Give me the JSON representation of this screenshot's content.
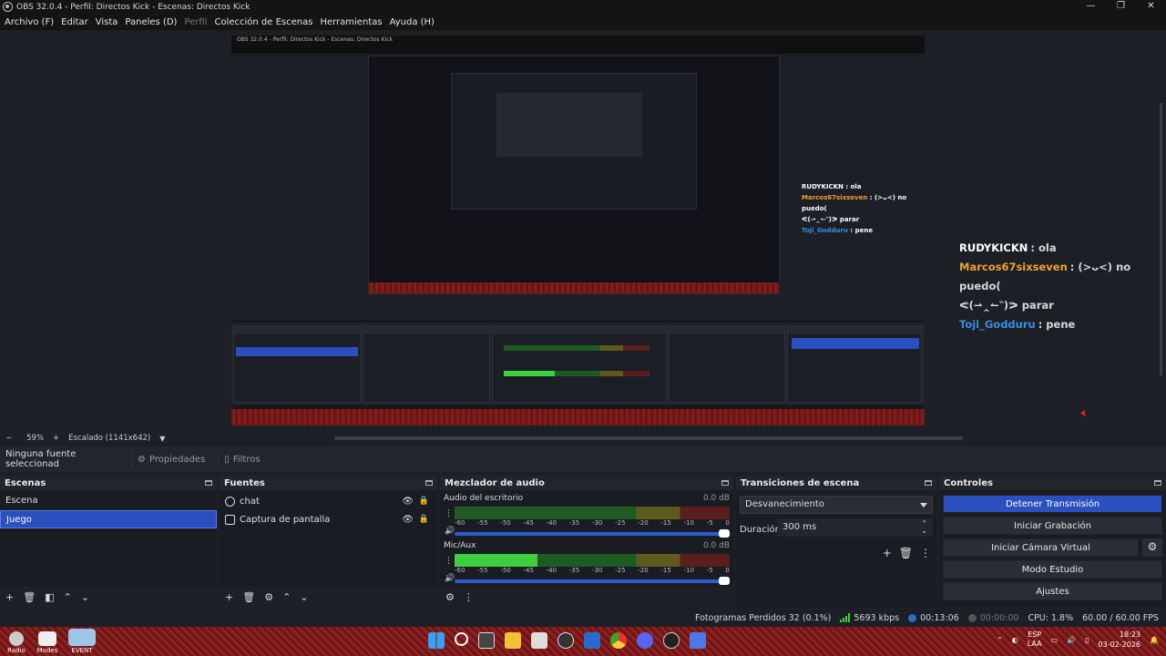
{
  "window": {
    "title": "OBS 32.0.4 - Perfil: Directos Kick - Escenas: Directos Kick",
    "controls": [
      "—",
      "❐",
      "✕"
    ]
  },
  "menu": [
    {
      "label": "Archivo (F)",
      "enabled": true
    },
    {
      "label": "Editar",
      "enabled": true
    },
    {
      "label": "Vista",
      "enabled": true
    },
    {
      "label": "Paneles (D)",
      "enabled": true
    },
    {
      "label": "Perfil",
      "enabled": false
    },
    {
      "label": "Colección de Escenas",
      "enabled": true
    },
    {
      "label": "Herramientas",
      "enabled": true
    },
    {
      "label": "Ayuda (H)",
      "enabled": true
    }
  ],
  "preview": {
    "nested_title": "OBS 32.0.4 - Perfil: Directos Kick - Escenas: Directos Kick",
    "nested_chat": [
      {
        "user": "RUDYKICKN",
        "msg": ": ola",
        "color": "#ffffff"
      },
      {
        "user": "Marcos67sixseven",
        "msg": ": (>ᴗ<)   no puedo(",
        "color": "#f0a030"
      },
      {
        "user": "",
        "msg": "ᕙ(⇀‸↼‶)ᕗ parar",
        "color": "#ffffff"
      },
      {
        "user": "Toji_Godduru",
        "msg": ": pene",
        "color": "#3a8de0"
      }
    ],
    "chat": [
      {
        "user": "RUDYKICKN",
        "msg": ": ola",
        "color": "#ffffff"
      },
      {
        "user": "Marcos67sixseven",
        "msg": ": (>ᴗ<)   no puedo(",
        "color": "#f0a030"
      },
      {
        "user": "",
        "msg": "ᕙ(⇀‸↼‶)ᕗ parar",
        "color": "#ffffff"
      },
      {
        "user": "Toji_Godduru",
        "msg": ": pene",
        "color": "#3a8de0"
      }
    ]
  },
  "zoombar": {
    "minus": "−",
    "zoom": "59%",
    "plus": "+",
    "scale": "Escalado (1141x642)"
  },
  "propbar": {
    "no_selection": "Ninguna fuente seleccionad",
    "properties": "Propiedades",
    "filters": "Filtros"
  },
  "scenes": {
    "title": "Escenas",
    "items": [
      "Escena",
      "Juego"
    ],
    "selected": 1
  },
  "sources": {
    "title": "Fuentes",
    "items": [
      "chat",
      "Captura de pantalla"
    ]
  },
  "mixer": {
    "title": "Mezclador de audio",
    "ticks": [
      "-60",
      "-55",
      "-50",
      "-45",
      "-40",
      "-35",
      "-30",
      "-25",
      "-20",
      "-15",
      "-10",
      "-5",
      "0"
    ],
    "channels": [
      {
        "name": "Audio del escritorio",
        "db": "0.0 dB",
        "level": 0.0
      },
      {
        "name": "Mic/Aux",
        "db": "0.0 dB",
        "level": 0.3
      }
    ]
  },
  "transitions": {
    "title": "Transiciones de escena",
    "selected": "Desvanecimiento",
    "duration_label": "Duración",
    "duration_value": "300 ms"
  },
  "controls": {
    "title": "Controles",
    "stop_stream": "Detener Transmisión",
    "start_recording": "Iniciar Grabación",
    "virtual_camera": "Iniciar Cámara Virtual",
    "studio_mode": "Modo Estudio",
    "settings": "Ajustes"
  },
  "status": {
    "dropped": "Fotogramas Perdidos 32 (0.1%)",
    "bitrate": "5693 kbps",
    "stream_time": "00:13:06",
    "rec_time": "00:00:00",
    "cpu": "CPU: 1.8%",
    "fps": "60.00 / 60.00 FPS"
  },
  "taskbar": {
    "apps": [
      "Radio",
      "Modes",
      "EVENT"
    ],
    "lang_top": "ESP",
    "lang_bottom": "LAA",
    "time": "18:23",
    "date": "03-02-2026"
  }
}
